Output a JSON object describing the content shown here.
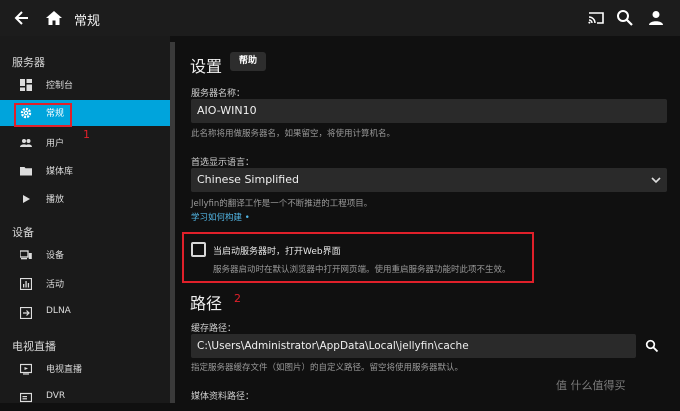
{
  "header": {
    "title": "常规"
  },
  "sidebar": {
    "section_server": "服务器",
    "section_devices": "设备",
    "section_livetv": "电视直播",
    "items": [
      {
        "label": "控制台",
        "icon": "dashboard-icon"
      },
      {
        "label": "常规",
        "icon": "gear-icon",
        "active": true
      },
      {
        "label": "用户",
        "icon": "users-icon"
      },
      {
        "label": "媒体库",
        "icon": "folder-icon"
      },
      {
        "label": "播放",
        "icon": "play-icon"
      },
      {
        "label": "设备",
        "icon": "devices-icon"
      },
      {
        "label": "活动",
        "icon": "activity-icon"
      },
      {
        "label": "DLNA",
        "icon": "dlna-icon"
      },
      {
        "label": "电视直播",
        "icon": "tv-icon"
      },
      {
        "label": "DVR",
        "icon": "dvr-icon"
      }
    ]
  },
  "annotations": {
    "one": "1",
    "two": "2"
  },
  "main": {
    "settings_title": "设置",
    "help_label": "帮助",
    "server_name_label": "服务器名称：",
    "server_name_value": "AIO-WIN10",
    "server_name_hint": "此名称将用做服务器名，如果留空，将使用计算机名。",
    "language_label": "首选显示语言：",
    "language_value": "Chinese Simplified",
    "language_hint": "Jellyfin的翻译工作是一个不断推进的工程项目。",
    "language_link": "学习如何构建 •",
    "launch_label": "当启动服务器时，打开Web界面",
    "launch_hint": "服务器启动时在默认浏览器中打开网页端。使用重启服务器功能时此项不生效。",
    "paths_title": "路径",
    "cache_label": "缓存路径：",
    "cache_value": "C:\\Users\\Administrator\\AppData\\Local\\jellyfin\\cache",
    "cache_hint": "指定服务器缓存文件（如图片）的自定义路径。留空将使用服务器默认。",
    "metadata_label": "媒体资料路径："
  },
  "watermark": "值 什么值得买",
  "colors": {
    "accent": "#00a4dc",
    "annotation": "#e0202a",
    "background": "#101010",
    "sidebar": "#1a1a1a"
  }
}
